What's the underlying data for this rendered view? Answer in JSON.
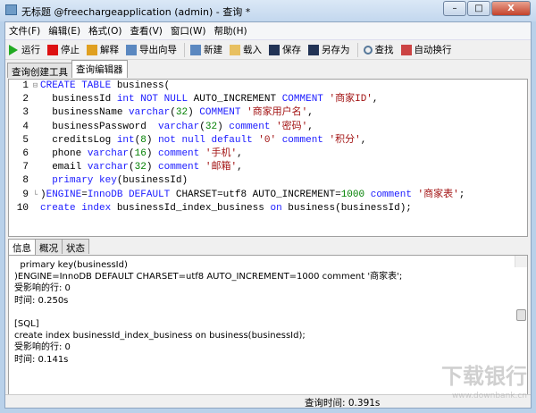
{
  "window": {
    "title": "无标题 @freechargeapplication (admin) - 查询 *",
    "min": "–",
    "max": "□",
    "close": "X"
  },
  "menu": [
    "文件(F)",
    "编辑(E)",
    "格式(O)",
    "查看(V)",
    "窗口(W)",
    "帮助(H)"
  ],
  "toolbar": [
    {
      "label": "运行",
      "icon": "play-icon",
      "color": "#22aa22"
    },
    {
      "label": "停止",
      "icon": "stop-icon",
      "color": "#dd1111"
    },
    {
      "label": "解释",
      "icon": "explain-icon",
      "color": "#e0a020"
    },
    {
      "label": "导出向导",
      "icon": "export-icon",
      "color": "#5b88c0"
    },
    {
      "label": "新建",
      "icon": "new-icon",
      "color": "#5b88c0"
    },
    {
      "label": "载入",
      "icon": "folder-icon",
      "color": "#e8c060"
    },
    {
      "label": "保存",
      "icon": "save-icon",
      "color": "#223355"
    },
    {
      "label": "另存为",
      "icon": "save-as-icon",
      "color": "#223355"
    },
    {
      "label": "查找",
      "icon": "search-icon",
      "color": "#557799"
    },
    {
      "label": "自动换行",
      "icon": "wrap-icon",
      "color": "#cc4444"
    }
  ],
  "tabs": [
    "查询创建工具",
    "查询编辑器"
  ],
  "editor": {
    "lines": [
      [
        [
          "kw",
          "CREATE TABLE "
        ],
        [
          "id",
          "business("
        ]
      ],
      [
        [
          "id",
          "  businessId "
        ],
        [
          "kw",
          "int NOT NULL "
        ],
        [
          "id",
          "AUTO_INCREMENT "
        ],
        [
          "kw",
          "COMMENT "
        ],
        [
          "str",
          "'商家ID'"
        ],
        [
          "id",
          ","
        ]
      ],
      [
        [
          "id",
          "  businessName "
        ],
        [
          "kw",
          "varchar"
        ],
        [
          "id",
          "("
        ],
        [
          "num",
          "32"
        ],
        [
          "id",
          ") "
        ],
        [
          "kw",
          "COMMENT "
        ],
        [
          "str",
          "'商家用户名'"
        ],
        [
          "id",
          ","
        ]
      ],
      [
        [
          "id",
          "  businessPassword  "
        ],
        [
          "kw",
          "varchar"
        ],
        [
          "id",
          "("
        ],
        [
          "num",
          "32"
        ],
        [
          "id",
          ") "
        ],
        [
          "kw",
          "comment "
        ],
        [
          "str",
          "'密码'"
        ],
        [
          "id",
          ","
        ]
      ],
      [
        [
          "id",
          "  creditsLog "
        ],
        [
          "kw",
          "int"
        ],
        [
          "id",
          "("
        ],
        [
          "num",
          "8"
        ],
        [
          "id",
          ") "
        ],
        [
          "kw",
          "not null default "
        ],
        [
          "str",
          "'0' "
        ],
        [
          "kw",
          "comment "
        ],
        [
          "str",
          "'积分'"
        ],
        [
          "id",
          ","
        ]
      ],
      [
        [
          "id",
          "  phone "
        ],
        [
          "kw",
          "varchar"
        ],
        [
          "id",
          "("
        ],
        [
          "num",
          "16"
        ],
        [
          "id",
          ") "
        ],
        [
          "kw",
          "comment "
        ],
        [
          "str",
          "'手机'"
        ],
        [
          "id",
          ","
        ]
      ],
      [
        [
          "id",
          "  email "
        ],
        [
          "kw",
          "varchar"
        ],
        [
          "id",
          "("
        ],
        [
          "num",
          "32"
        ],
        [
          "id",
          ") "
        ],
        [
          "kw",
          "comment "
        ],
        [
          "str",
          "'邮箱'"
        ],
        [
          "id",
          ","
        ]
      ],
      [
        [
          "id",
          "  "
        ],
        [
          "kw",
          "primary key"
        ],
        [
          "id",
          "(businessId)"
        ]
      ],
      [
        [
          "id",
          ")"
        ],
        [
          "kw",
          "ENGINE"
        ],
        [
          "id",
          "="
        ],
        [
          "kw",
          "InnoDB DEFAULT "
        ],
        [
          "id",
          "CHARSET=utf8 AUTO_INCREMENT="
        ],
        [
          "num",
          "1000 "
        ],
        [
          "kw",
          "comment "
        ],
        [
          "str",
          "'商家表'"
        ],
        [
          "id",
          ";"
        ]
      ],
      [
        [
          "kw",
          "create index "
        ],
        [
          "id",
          "businessId_index_business "
        ],
        [
          "kw",
          "on "
        ],
        [
          "id",
          "business(businessId);"
        ]
      ]
    ]
  },
  "result_tabs": [
    "信息",
    "概况",
    "状态"
  ],
  "result_lines": [
    "  primary key(businessId)",
    ")ENGINE=InnoDB DEFAULT CHARSET=utf8 AUTO_INCREMENT=1000 comment '商家表';",
    "受影响的行: 0",
    "时间: 0.250s",
    "",
    "[SQL]",
    "create index businessId_index_business on business(businessId);",
    "受影响的行: 0",
    "时间: 0.141s"
  ],
  "status": {
    "query_time": "查询时间: 0.391s"
  },
  "watermark": {
    "text": "下载银行",
    "url": "www.downbank.cn"
  }
}
